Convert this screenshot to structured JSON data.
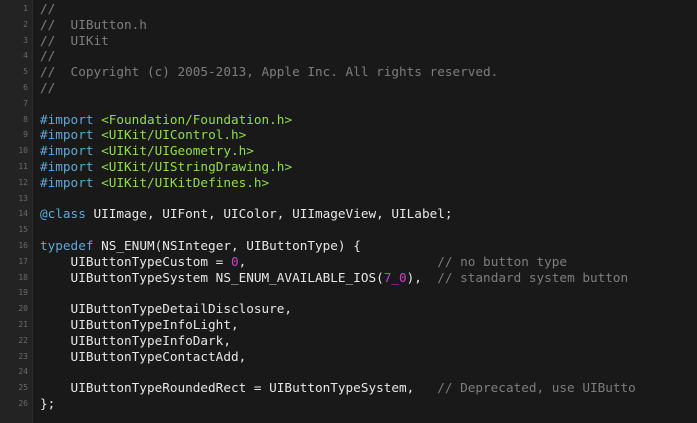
{
  "editor": {
    "line_numbers": [
      "1",
      "2",
      "3",
      "4",
      "5",
      "6",
      "7",
      "8",
      "9",
      "10",
      "11",
      "12",
      "13",
      "14",
      "15",
      "16",
      "17",
      "18",
      "19",
      "20",
      "21",
      "22",
      "23",
      "24",
      "25",
      "26"
    ],
    "lines": [
      [
        {
          "t": "//",
          "c": "comment"
        }
      ],
      [
        {
          "t": "//  UIButton.h",
          "c": "comment"
        }
      ],
      [
        {
          "t": "//  UIKit",
          "c": "comment"
        }
      ],
      [
        {
          "t": "//",
          "c": "comment"
        }
      ],
      [
        {
          "t": "//  Copyright (c) 2005-2013, Apple Inc. All rights reserved.",
          "c": "comment"
        }
      ],
      [
        {
          "t": "//",
          "c": "comment"
        }
      ],
      [],
      [
        {
          "t": "#import",
          "c": "directive"
        },
        {
          "t": " ",
          "c": "plain"
        },
        {
          "t": "<Foundation/Foundation.h>",
          "c": "string"
        }
      ],
      [
        {
          "t": "#import",
          "c": "directive"
        },
        {
          "t": " ",
          "c": "plain"
        },
        {
          "t": "<UIKit/UIControl.h>",
          "c": "string"
        }
      ],
      [
        {
          "t": "#import",
          "c": "directive"
        },
        {
          "t": " ",
          "c": "plain"
        },
        {
          "t": "<UIKit/UIGeometry.h>",
          "c": "string"
        }
      ],
      [
        {
          "t": "#import",
          "c": "directive"
        },
        {
          "t": " ",
          "c": "plain"
        },
        {
          "t": "<UIKit/UIStringDrawing.h>",
          "c": "string"
        }
      ],
      [
        {
          "t": "#import",
          "c": "directive"
        },
        {
          "t": " ",
          "c": "plain"
        },
        {
          "t": "<UIKit/UIKitDefines.h>",
          "c": "string"
        }
      ],
      [],
      [
        {
          "t": "@class",
          "c": "keyword"
        },
        {
          "t": " UIImage, UIFont, UIColor, UIImageView, UILabel;",
          "c": "plain"
        }
      ],
      [],
      [
        {
          "t": "typedef",
          "c": "keyword"
        },
        {
          "t": " NS_ENUM(NSInteger, UIButtonType) {",
          "c": "plain"
        }
      ],
      [
        {
          "t": "    UIButtonTypeCustom = ",
          "c": "plain"
        },
        {
          "t": "0",
          "c": "number"
        },
        {
          "t": ",                         ",
          "c": "plain"
        },
        {
          "t": "// no button type",
          "c": "comment"
        }
      ],
      [
        {
          "t": "    UIButtonTypeSystem NS_ENUM_AVAILABLE_IOS(",
          "c": "plain"
        },
        {
          "t": "7_0",
          "c": "number"
        },
        {
          "t": "),  ",
          "c": "plain"
        },
        {
          "t": "// standard system button",
          "c": "comment"
        }
      ],
      [],
      [
        {
          "t": "    UIButtonTypeDetailDisclosure,",
          "c": "plain"
        }
      ],
      [
        {
          "t": "    UIButtonTypeInfoLight,",
          "c": "plain"
        }
      ],
      [
        {
          "t": "    UIButtonTypeInfoDark,",
          "c": "plain"
        }
      ],
      [
        {
          "t": "    UIButtonTypeContactAdd,",
          "c": "plain"
        }
      ],
      [],
      [
        {
          "t": "    UIButtonTypeRoundedRect = UIButtonTypeSystem,   ",
          "c": "plain"
        },
        {
          "t": "// Deprecated, use UIButto",
          "c": "comment"
        }
      ],
      [
        {
          "t": "};",
          "c": "plain"
        }
      ]
    ]
  }
}
